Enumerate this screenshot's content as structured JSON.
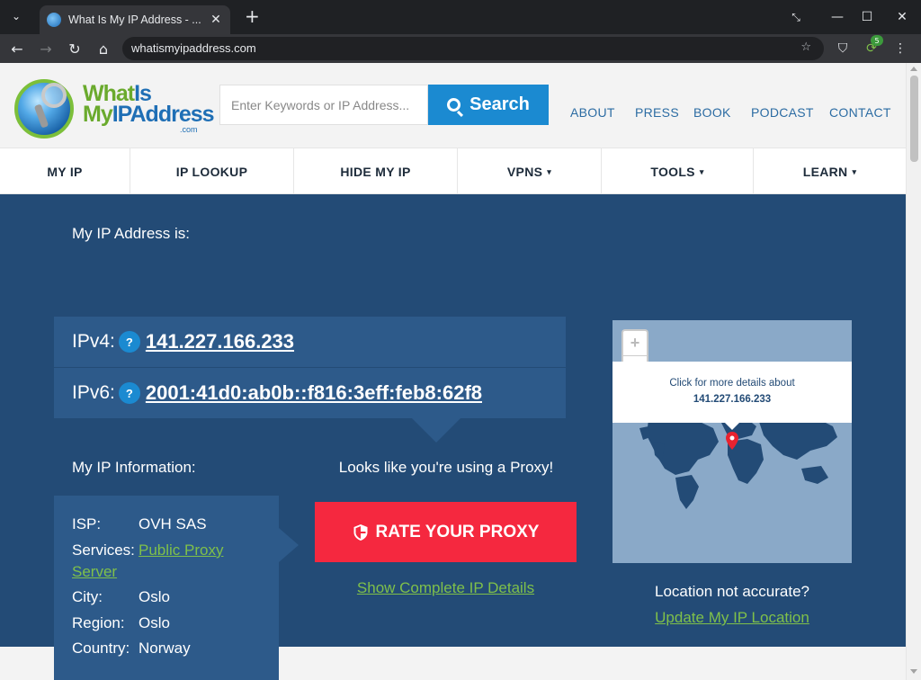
{
  "browser": {
    "tab_title": "What Is My IP Address - ...",
    "url": "whatismyipaddress.com",
    "extension_badge": "5"
  },
  "site": {
    "logo_line1_a": "What",
    "logo_line1_b": "Is",
    "logo_line2_a": "My",
    "logo_line2_b": "IPAddress",
    "logo_suffix": ".com",
    "search_placeholder": "Enter Keywords or IP Address...",
    "search_button": "Search",
    "top_links": [
      "ABOUT",
      "PRESS",
      "BOOK",
      "PODCAST",
      "CONTACT"
    ],
    "nav": [
      {
        "label": "MY IP",
        "caret": ""
      },
      {
        "label": "IP LOOKUP",
        "caret": ""
      },
      {
        "label": "HIDE MY IP",
        "caret": ""
      },
      {
        "label": "VPNS",
        "caret": "▾"
      },
      {
        "label": "TOOLS",
        "caret": "▾"
      },
      {
        "label": "LEARN",
        "caret": "▾"
      }
    ]
  },
  "ip": {
    "heading": "My IP Address is:",
    "ipv4_label": "IPv4:",
    "ipv4": "141.227.166.233",
    "ipv6_label": "IPv6:",
    "ipv6": "2001:41d0:ab0b::f816:3eff:feb8:62f8",
    "help": "?"
  },
  "info": {
    "heading": "My IP Information:",
    "isp_key": "ISP:",
    "isp": "OVH SAS",
    "services_key": "Services:",
    "services_line1": "Public Proxy",
    "services_line2": "Server",
    "city_key": "City:",
    "city": "Oslo",
    "region_key": "Region:",
    "region": "Oslo",
    "country_key": "Country:",
    "country": "Norway"
  },
  "proxy": {
    "notice": "Looks like you're using a Proxy!",
    "rate_button": "RATE YOUR PROXY",
    "details_link": "Show Complete IP Details"
  },
  "map": {
    "zoom_in": "+",
    "zoom_out": "−",
    "popup_line1": "Click for more details about",
    "popup_ip": "141.227.166.233"
  },
  "location": {
    "question": "Location not accurate?",
    "update_link": "Update My IP Location"
  },
  "colors": {
    "brand_blue": "#234b76",
    "accent_red": "#f5283f",
    "link_green": "#7fc04a",
    "search_blue": "#1b8ad1"
  }
}
